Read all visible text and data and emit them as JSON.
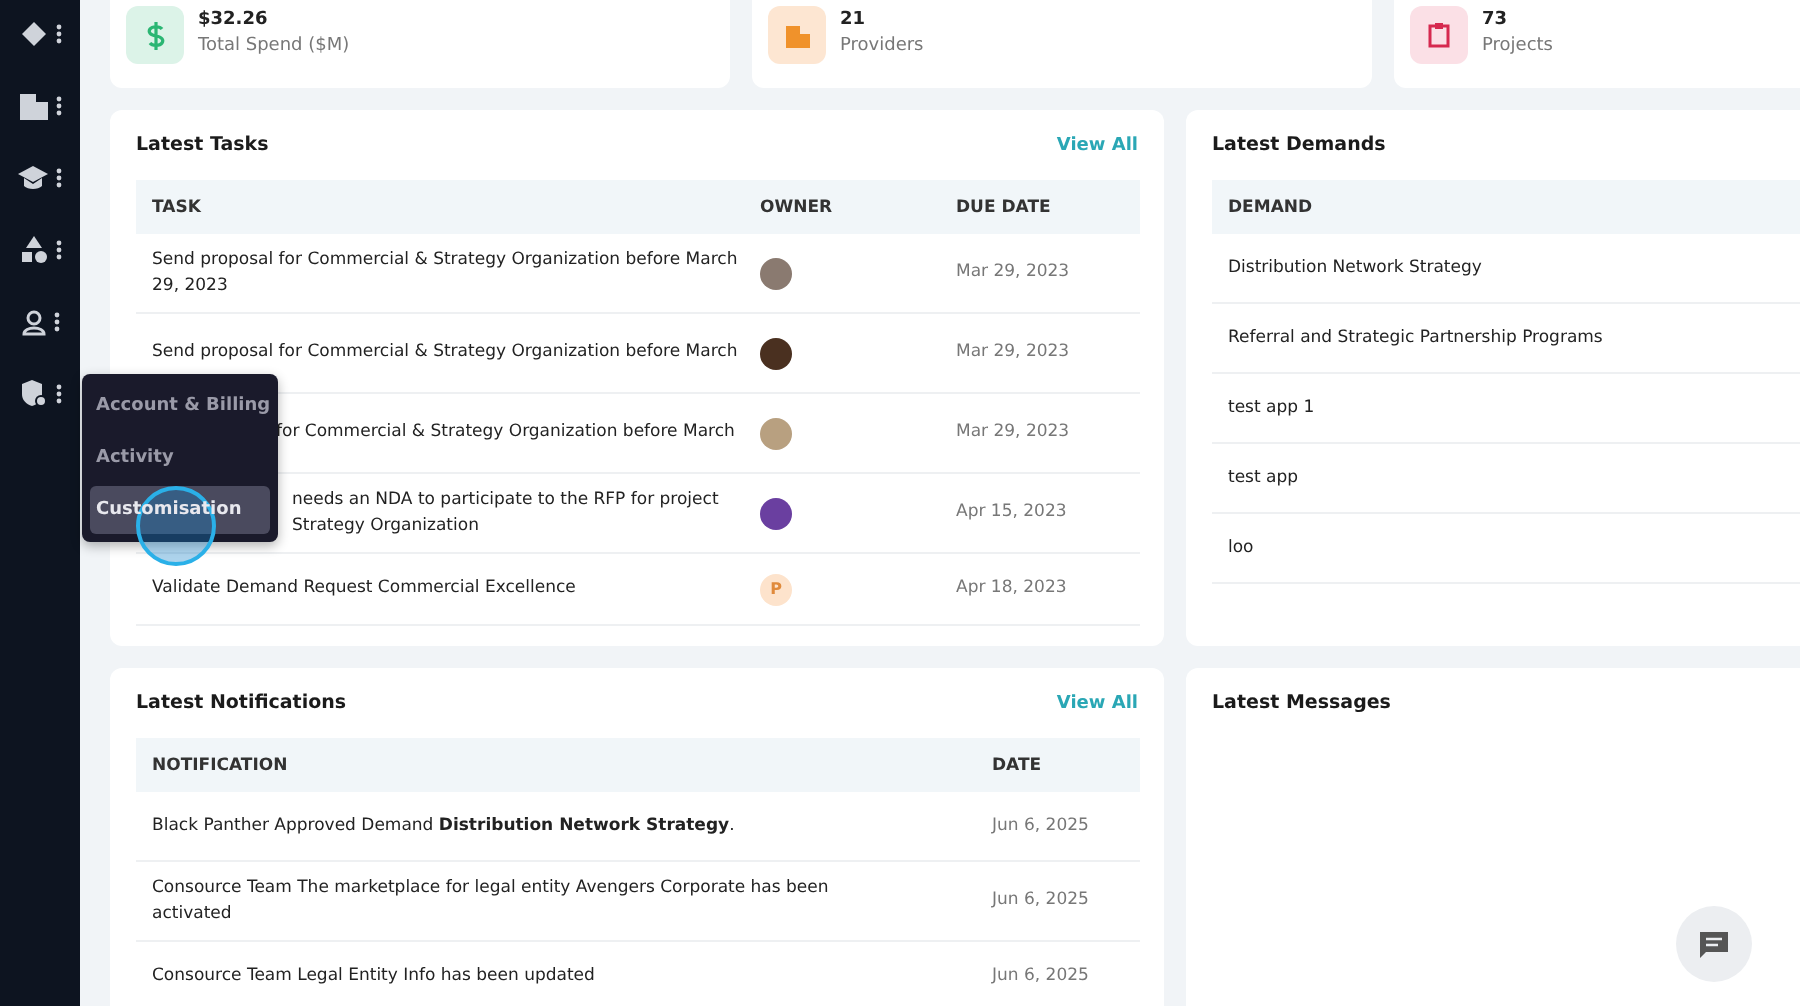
{
  "popup_menu": {
    "items": [
      {
        "label": "Account & Billing",
        "selected": false
      },
      {
        "label": "Activity",
        "selected": false
      },
      {
        "label": "Customisation",
        "selected": true
      }
    ]
  },
  "stats": [
    {
      "value": "$32.26",
      "label": "Total Spend ($M)",
      "kind": "money"
    },
    {
      "value": "21",
      "label": "Providers",
      "kind": "building"
    },
    {
      "value": "73",
      "label": "Projects",
      "kind": "clipboard"
    }
  ],
  "latest_tasks": {
    "title": "Latest Tasks",
    "link": "View All",
    "columns": [
      "TASK",
      "OWNER",
      "DUE DATE"
    ],
    "rows": [
      {
        "task": [
          "Send proposal for Commercial & Strategy Organization before March",
          "29, 2023"
        ],
        "kind": "full",
        "owner": {
          "kind": "photo"
        },
        "due": "Mar 29, 2023"
      },
      {
        "task": [
          "Send proposal for Commercial & Strategy Organization before March"
        ],
        "kind": "full",
        "owner": {
          "kind": "photo"
        },
        "due": "Mar 29, 2023"
      },
      {
        "task": [
          "for Commercial & Strategy Organization before March"
        ],
        "kind": "cut",
        "owner": {
          "kind": "photo"
        },
        "due": "Mar 29, 2023"
      },
      {
        "task": [
          "needs an NDA to participate to the RFP for project",
          "Strategy Organization"
        ],
        "kind": "cut",
        "owner": {
          "kind": "logo"
        },
        "due": "Apr 15, 2023"
      },
      {
        "task": [
          "Validate Demand Request Commercial Excellence"
        ],
        "kind": "full",
        "owner": {
          "kind": "initial",
          "initial": "P"
        },
        "due": "Apr 18, 2023"
      }
    ]
  },
  "latest_demands": {
    "title": "Latest Demands",
    "columns": [
      "DEMAND"
    ],
    "rows": [
      "Distribution Network Strategy",
      "Referral and Strategic Partnership Programs",
      "test app 1",
      "test app",
      "loo"
    ]
  },
  "latest_notifications": {
    "title": "Latest Notifications",
    "link": "View All",
    "columns": [
      "NOTIFICATION",
      "DATE"
    ],
    "rows": [
      {
        "text": "Black Panther Approved Demand **Distribution Network Strategy**.",
        "date": "Jun 6, 2025"
      },
      {
        "text": "Consource Team The marketplace for legal entity Avengers Corporate has been activated",
        "date": "Jun 6, 2025"
      },
      {
        "text": "Consource Team Legal Entity Info has been updated",
        "date": "Jun 6, 2025"
      }
    ]
  },
  "latest_messages": {
    "title": "Latest Messages"
  }
}
